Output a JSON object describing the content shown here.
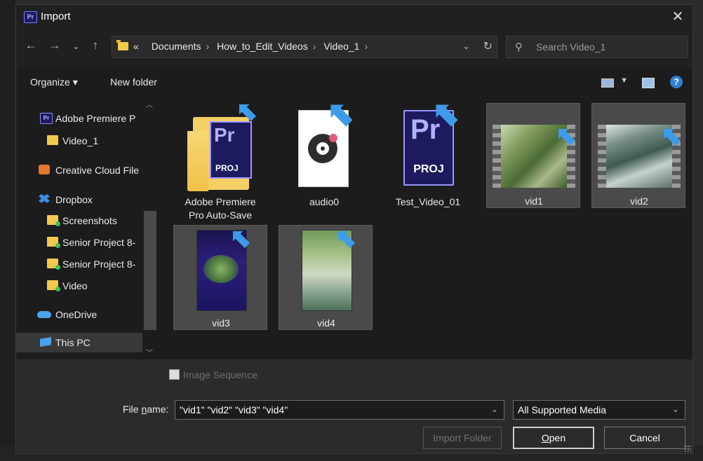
{
  "window": {
    "title": "Import",
    "app_badge": "Pr"
  },
  "address": {
    "crumbs": [
      "Documents",
      "How_to_Edit_Videos",
      "Video_1"
    ],
    "overflow": "«"
  },
  "search": {
    "placeholder": "Search Video_1"
  },
  "toolbar": {
    "organize": "Organize ▾",
    "new_folder": "New folder"
  },
  "nav": [
    {
      "label": "Adobe Premiere P",
      "icon": "premiere-icon"
    },
    {
      "label": "Video_1",
      "icon": "folder-icon"
    },
    {
      "label": "Creative Cloud File",
      "icon": "creative-cloud-icon"
    },
    {
      "label": "Dropbox",
      "icon": "dropbox-icon"
    },
    {
      "label": "Screenshots",
      "icon": "folder-synced-icon"
    },
    {
      "label": "Senior Project 8-",
      "icon": "folder-synced-icon"
    },
    {
      "label": "Senior Project 8-",
      "icon": "folder-synced-icon"
    },
    {
      "label": "Video",
      "icon": "folder-synced-icon"
    },
    {
      "label": "OneDrive",
      "icon": "onedrive-icon"
    },
    {
      "label": "This PC",
      "icon": "pc-icon"
    }
  ],
  "files": [
    {
      "name": "Adobe Premiere Pro Auto-Save",
      "line1": "Adobe Premiere",
      "line2": "Pro Auto-Save",
      "kind": "folder",
      "selected": false
    },
    {
      "name": "audio0",
      "kind": "audio",
      "selected": false
    },
    {
      "name": "Test_Video_01",
      "kind": "project",
      "selected": false
    },
    {
      "name": "vid1",
      "kind": "video",
      "selected": true
    },
    {
      "name": "vid2",
      "kind": "video",
      "selected": true
    },
    {
      "name": "vid3",
      "kind": "video",
      "selected": true
    },
    {
      "name": "vid4",
      "kind": "video",
      "selected": true
    }
  ],
  "thumb_text": {
    "pr": "Pr",
    "proj": "PROJ"
  },
  "footer": {
    "image_sequence": "Image Sequence",
    "file_name_label_pre": "File ",
    "file_name_label_u": "n",
    "file_name_label_post": "ame:",
    "file_name_value": "\"vid1\" \"vid2\" \"vid3\" \"vid4\"",
    "file_type": "All Supported Media",
    "import_folder": "Import Folder",
    "open_u": "O",
    "open_rest": "pen",
    "cancel": "Cancel"
  },
  "colors": {
    "accent": "#3d9be9",
    "premiere": "#1d1b5e",
    "selection": "#4a4a4a"
  }
}
